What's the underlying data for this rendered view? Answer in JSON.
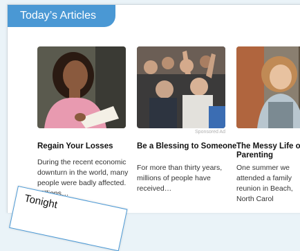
{
  "header": {
    "title": "Today’s Articles"
  },
  "articles": [
    {
      "title": "Regain Your Losses",
      "excerpt": "During the recent economic downturn in the world, many people were badly affected. Millions…",
      "sponsored": ""
    },
    {
      "title": "Be a Blessing to Someone",
      "excerpt": "For more than thirty years, millions of people have received…",
      "sponsored": "Sponsored Ad"
    },
    {
      "title": "The Messy Life of Parenting",
      "excerpt": "One summer we attended a family reunion in Beach, North Carol",
      "sponsored": ""
    }
  ],
  "tonight": {
    "label": "Tonight"
  },
  "colors": {
    "accent": "#4a98d4",
    "page_bg": "#eaf3f8"
  }
}
